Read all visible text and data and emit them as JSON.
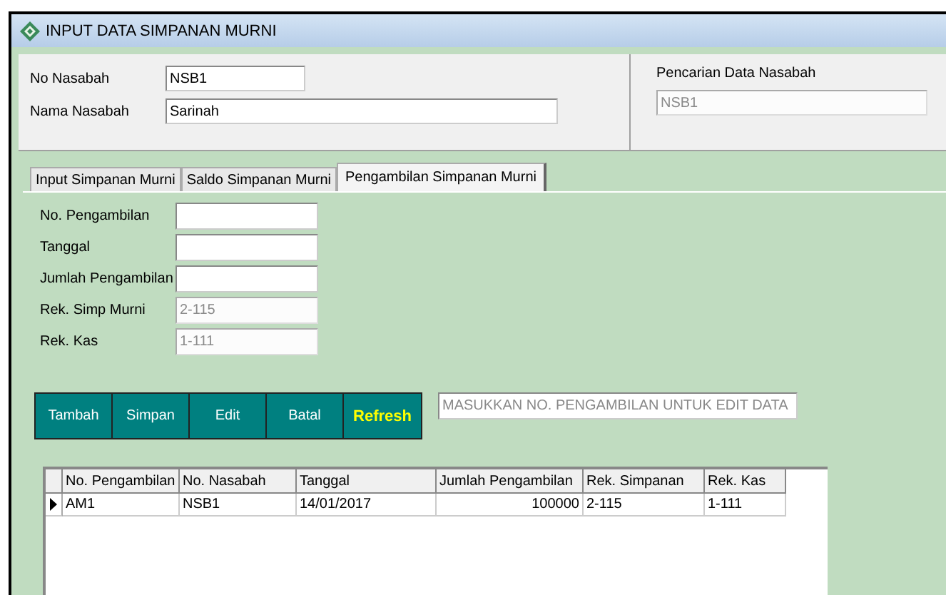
{
  "window": {
    "title": "INPUT DATA SIMPANAN MURNI"
  },
  "customer": {
    "fields": [
      {
        "label": "No Nasabah",
        "value": "NSB1"
      },
      {
        "label": "Nama Nasabah",
        "value": "Sarinah"
      }
    ],
    "search": {
      "label": "Pencarian Data Nasabah",
      "value": "NSB1",
      "disabled": true
    }
  },
  "tabs": [
    {
      "label": "Input Simpanan Murni",
      "selected": false
    },
    {
      "label": "Saldo Simpanan Murni",
      "selected": false
    },
    {
      "label": "Pengambilan Simpanan Murni",
      "selected": true
    }
  ],
  "form": [
    {
      "label": "No. Pengambilan",
      "disabled": false
    },
    {
      "label": "Tanggal",
      "disabled": false
    },
    {
      "label": "Jumlah Pengambilan",
      "disabled": false
    },
    {
      "label": "Rek. Simp Murni",
      "value": "2-115",
      "disabled": true
    },
    {
      "label": "Rek. Kas",
      "value": "1-111",
      "disabled": true
    }
  ],
  "buttons": [
    {
      "label": "Tambah",
      "highlighted": false
    },
    {
      "label": "Simpan",
      "highlighted": false
    },
    {
      "label": "Edit",
      "highlighted": false
    },
    {
      "label": "Batal",
      "highlighted": false
    },
    {
      "label": "Refresh",
      "highlighted": true
    }
  ],
  "edit_search": {
    "placeholder": "MASUKKAN NO. PENGAMBILAN UNTUK EDIT DATA"
  },
  "table": {
    "columns": [
      "No. Pengambilan",
      "No. Nasabah",
      "Tanggal",
      "Jumlah Pengambilan",
      "Rek. Simpanan",
      "Rek. Kas"
    ],
    "rows": [
      {
        "selected": true,
        "cells": [
          "AM1",
          "NSB1",
          "14/01/2017",
          "100000",
          "2-115",
          "1-111"
        ]
      }
    ]
  }
}
